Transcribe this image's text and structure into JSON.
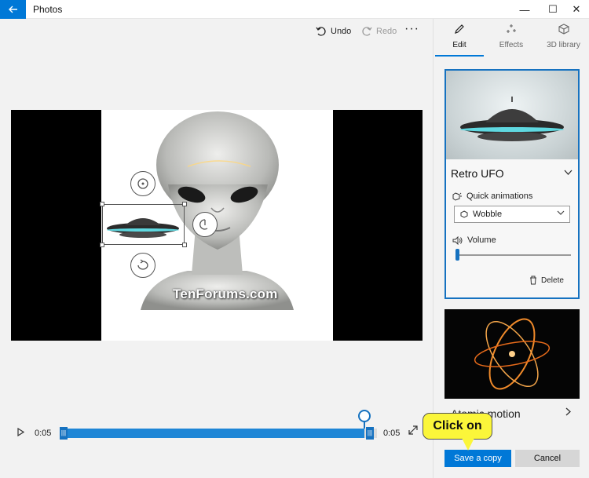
{
  "window": {
    "title": "Photos",
    "back_icon": "back-arrow-icon",
    "minimize_glyph": "—",
    "maximize_glyph": "☐",
    "close_glyph": "✕"
  },
  "toolbar": {
    "undo_label": "Undo",
    "redo_label": "Redo",
    "more_glyph": "···"
  },
  "canvas": {
    "watermark": "TenForums.com"
  },
  "timeline": {
    "current_time": "0:05",
    "end_time": "0:05",
    "progress": 0.96
  },
  "panel": {
    "tabs": [
      {
        "label": "Edit",
        "icon": "pencil-icon",
        "selected": true
      },
      {
        "label": "Effects",
        "icon": "sparkle-icon",
        "selected": false
      },
      {
        "label": "3D library",
        "icon": "cube-icon",
        "selected": false
      }
    ],
    "selected_model": {
      "title": "Retro UFO",
      "quick_animations_label": "Quick animations",
      "animation_value": "Wobble",
      "volume_label": "Volume",
      "volume_level": 0.0,
      "delete_label": "Delete"
    },
    "second_effect": {
      "title": "Atomic motion"
    },
    "save_label": "Save a copy",
    "cancel_label": "Cancel"
  },
  "callout": {
    "text": "Click on"
  },
  "colors": {
    "accent": "#0078d7",
    "callout_bg": "#fbf63a"
  }
}
